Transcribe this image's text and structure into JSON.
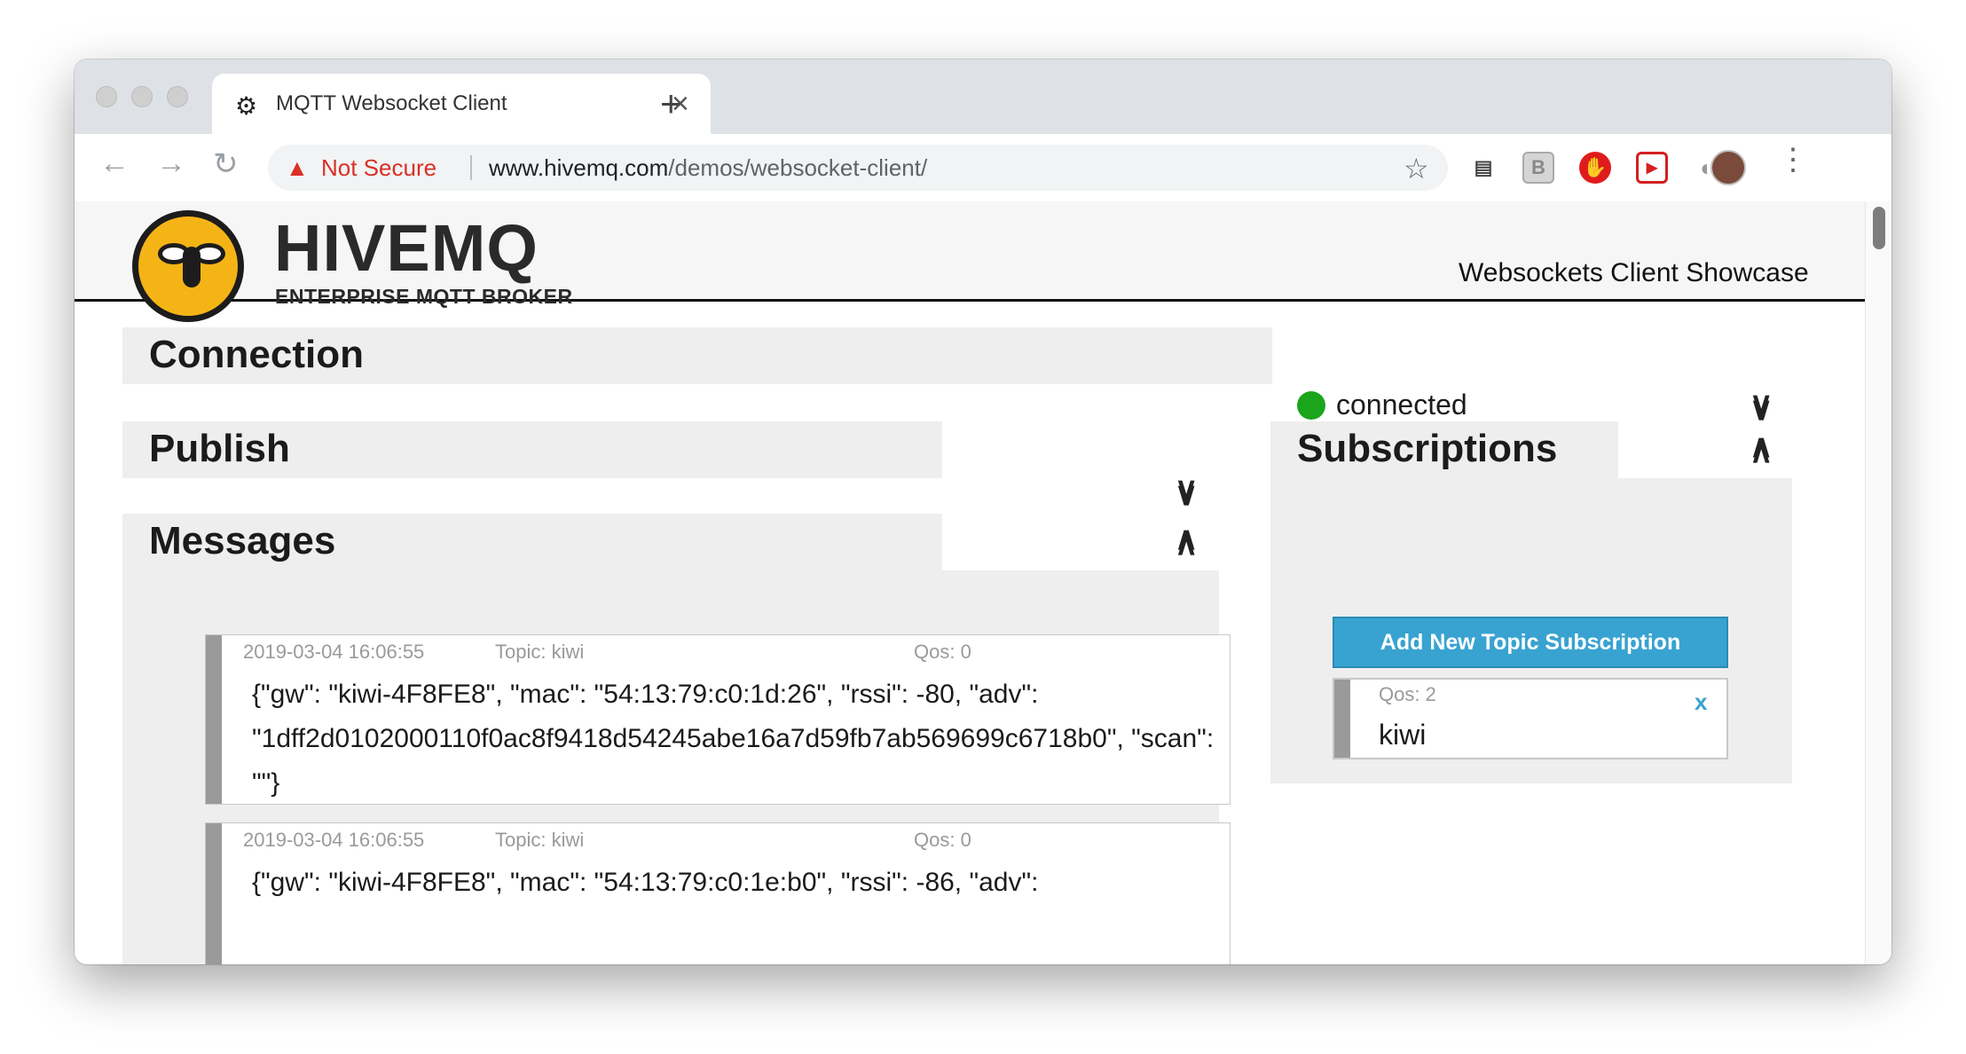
{
  "browser": {
    "tab_icon": "hivemq-favicon-icon",
    "tab_title": "MQTT Websocket Client",
    "tab_close": "×",
    "new_tab": "+",
    "security_label": "Not Secure",
    "url_host": "www.hivemq.com",
    "url_path": "/demos/websocket-client/"
  },
  "site": {
    "logo_word": "HIVEMQ",
    "logo_tagline": "ENTERPRISE MQTT BROKER",
    "header_title": "Websockets Client Showcase"
  },
  "connection": {
    "title": "Connection",
    "status": "connected",
    "status_color": "#1aa51a"
  },
  "publish": {
    "title": "Publish"
  },
  "messages": {
    "title": "Messages",
    "items": [
      {
        "timestamp": "2019-03-04 16:06:55",
        "topic": "Topic: kiwi",
        "qos": "Qos: 0",
        "payload": "{\"gw\": \"kiwi-4F8FE8\", \"mac\": \"54:13:79:c0:1d:26\", \"rssi\": -80, \"adv\": \"1dff2d0102000110f0ac8f9418d54245abe16a7d59fb7ab569699c6718b0\", \"scan\": \"\"}"
      },
      {
        "timestamp": "2019-03-04 16:06:55",
        "topic": "Topic: kiwi",
        "qos": "Qos: 0",
        "payload": "{\"gw\": \"kiwi-4F8FE8\", \"mac\": \"54:13:79:c0:1e:b0\", \"rssi\": -86, \"adv\":"
      }
    ]
  },
  "subscriptions": {
    "title": "Subscriptions",
    "add_button": "Add New Topic Subscription",
    "items": [
      {
        "qos": "Qos: 2",
        "topic": "kiwi",
        "remove": "x"
      }
    ]
  },
  "accent_color": "#38a3d1"
}
